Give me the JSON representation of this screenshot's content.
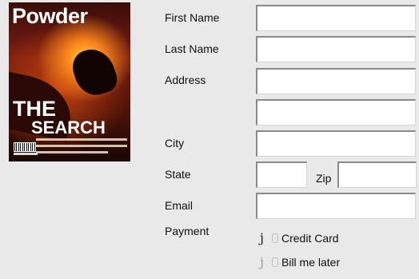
{
  "cover": {
    "brand": "Powder",
    "headline_1": "THE",
    "headline_2": "SEARCH"
  },
  "form": {
    "first_name_label": "First Name",
    "last_name_label": "Last Name",
    "address_label": "Address",
    "city_label": "City",
    "state_label": "State",
    "zip_label": "Zip",
    "email_label": "Email",
    "payment_label": "Payment",
    "first_name_value": "",
    "last_name_value": "",
    "address_line1_value": "",
    "address_line2_value": "",
    "city_value": "",
    "state_value": "",
    "zip_value": "",
    "email_value": ""
  },
  "payment": {
    "options": [
      "Credit Card",
      "Bill me later"
    ],
    "selected": "Credit Card"
  }
}
